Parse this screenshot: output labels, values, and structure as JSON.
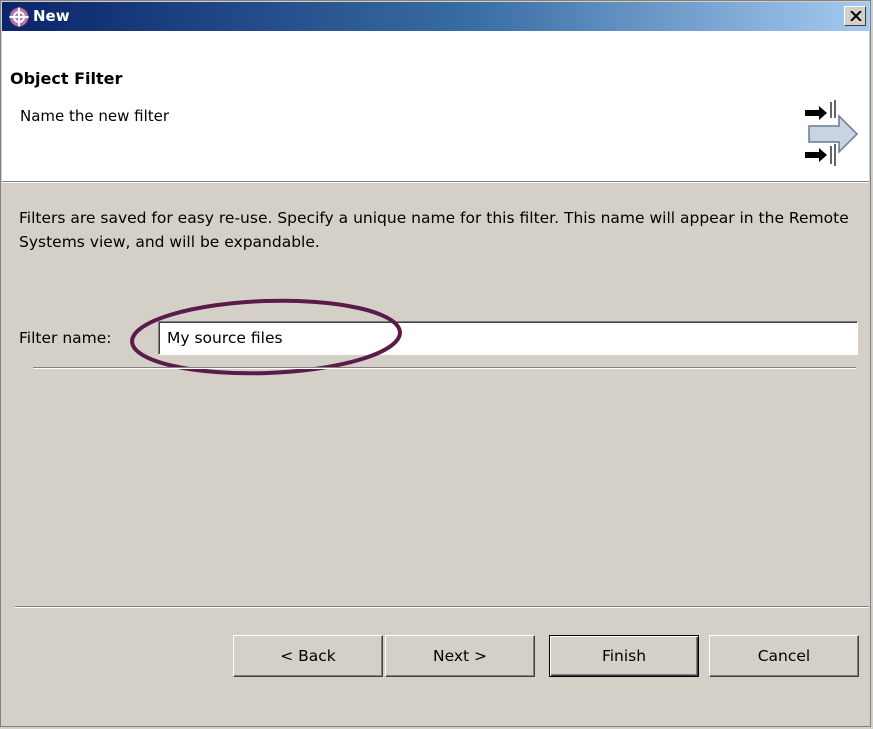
{
  "window": {
    "title": "New",
    "title_icon": "eclipse-new-wizard-icon",
    "close_icon": "close-icon"
  },
  "header": {
    "title": "Object Filter",
    "subtitle": "Name the new filter",
    "icon": "wizard-arrows-icon"
  },
  "body": {
    "description": "Filters are saved for easy re-use. Specify a unique name for this filter. This name will appear in the Remote Systems view, and will be expandable.",
    "filter_label": "Filter name:",
    "filter_value": "My source files"
  },
  "buttons": {
    "back": "< Back",
    "next": "Next >",
    "finish": "Finish",
    "cancel": "Cancel"
  },
  "colors": {
    "title_start": "#0a246a",
    "title_end": "#a6caf0",
    "annotation_oval": "#5a1a4a",
    "dialog_bg": "#d4d0c8"
  }
}
